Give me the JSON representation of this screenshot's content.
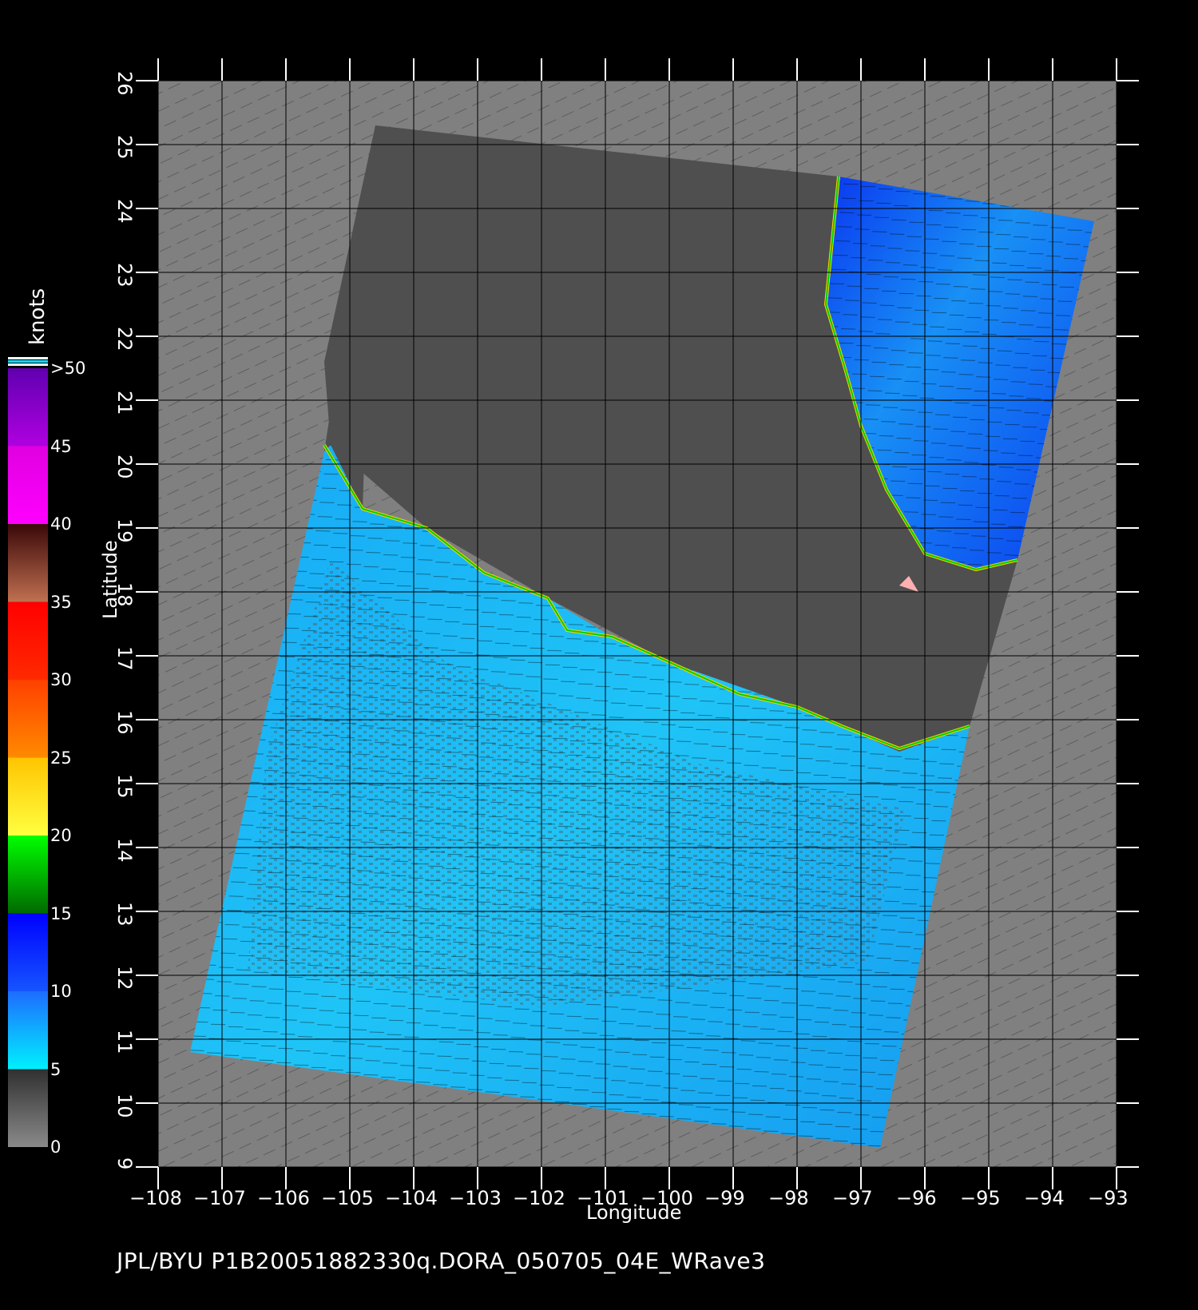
{
  "map": {
    "units_label": "knots",
    "x_axis_label": "Longitude",
    "y_axis_label": "Latitude",
    "footer_text": "JPL/BYU  P1B20051882330q.DORA_050705_04E_WRave3",
    "lon_range": [
      -108,
      -93
    ],
    "lat_range": [
      9,
      26
    ],
    "lon_ticks": [
      "−108",
      "−107",
      "−106",
      "−105",
      "−104",
      "−103",
      "−102",
      "−101",
      "−100",
      "−99",
      "−98",
      "−97",
      "−96",
      "−95",
      "−94",
      "−93"
    ],
    "lat_ticks": [
      "9",
      "10",
      "11",
      "12",
      "13",
      "14",
      "15",
      "16",
      "17",
      "18",
      "19",
      "20",
      "21",
      "22",
      "23",
      "24",
      "25",
      "26"
    ],
    "grid": true
  },
  "colorbar": {
    "ticks": [
      "0",
      "5",
      "10",
      "15",
      "20",
      "25",
      "30",
      "35",
      "40",
      "45",
      ">50"
    ],
    "segments": [
      {
        "from": 0,
        "to": 5,
        "color_top": "#303030",
        "color_bottom": "#8a8a8a"
      },
      {
        "from": 5,
        "to": 10,
        "color_top": "#1e6cff",
        "color_bottom": "#00f0ff"
      },
      {
        "from": 10,
        "to": 15,
        "color_top": "#0000ff",
        "color_bottom": "#1555ff"
      },
      {
        "from": 15,
        "to": 20,
        "color_top": "#00ff00",
        "color_bottom": "#006a00"
      },
      {
        "from": 20,
        "to": 25,
        "color_top": "#ffc400",
        "color_bottom": "#ffff40"
      },
      {
        "from": 25,
        "to": 30,
        "color_top": "#ff4000",
        "color_bottom": "#ff8a00"
      },
      {
        "from": 30,
        "to": 35,
        "color_top": "#ff0000",
        "color_bottom": "#ff2a00"
      },
      {
        "from": 35,
        "to": 40,
        "color_top": "#3a0808",
        "color_bottom": "#c07050"
      },
      {
        "from": 40,
        "to": 45,
        "color_top": "#e000e0",
        "color_bottom": "#ff00ff"
      },
      {
        "from": 45,
        "to": 50,
        "color_top": "#6000b0",
        "color_bottom": "#b000e0"
      }
    ]
  },
  "colors": {
    "background": "#000000",
    "map_background": "#808080",
    "land": "#4f4f4f",
    "ocean_light": "#1fb8f5",
    "ocean_dark": "#1a5ff0",
    "grid": "#000000",
    "axes": "#ffffff"
  }
}
